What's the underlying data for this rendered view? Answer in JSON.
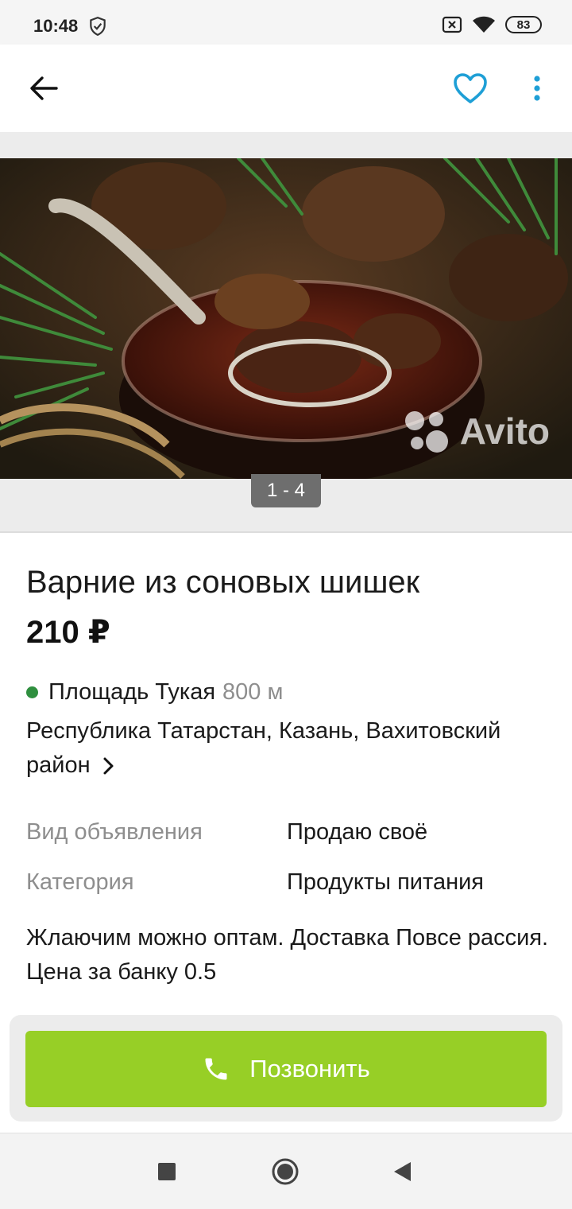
{
  "status_bar": {
    "time": "10:48",
    "battery": "83",
    "icons": [
      "shield-icon",
      "sim-off-icon",
      "wifi-icon",
      "battery-icon"
    ]
  },
  "app_bar": {
    "back_icon": "arrow-left-icon",
    "favorite_icon": "heart-outline-icon",
    "more_icon": "more-vertical-icon",
    "accent_color": "#1e9fd6"
  },
  "gallery": {
    "counter": "1 - 4",
    "watermark": "Avito"
  },
  "listing": {
    "title": "Варние из соновых шишек",
    "price": "210 ₽",
    "metro": {
      "station": "Площадь Тукая",
      "distance": "800 м",
      "line_color": "#2f8f3f"
    },
    "address": "Республика Татарстан, Казань, Вахитовский район",
    "params": [
      {
        "label": "Вид объявления",
        "value": "Продаю своё"
      },
      {
        "label": "Категория",
        "value": "Продукты питания"
      }
    ],
    "description": "Жлаючим можно оптам. Доставка Повсе рассия. Цена за банку 0.5"
  },
  "call_button": {
    "label": "Позвонить",
    "color": "#97cf26",
    "icon": "phone-icon"
  },
  "nav_bar": {
    "icons": [
      "recent-apps-icon",
      "home-icon",
      "back-triangle-icon"
    ]
  }
}
